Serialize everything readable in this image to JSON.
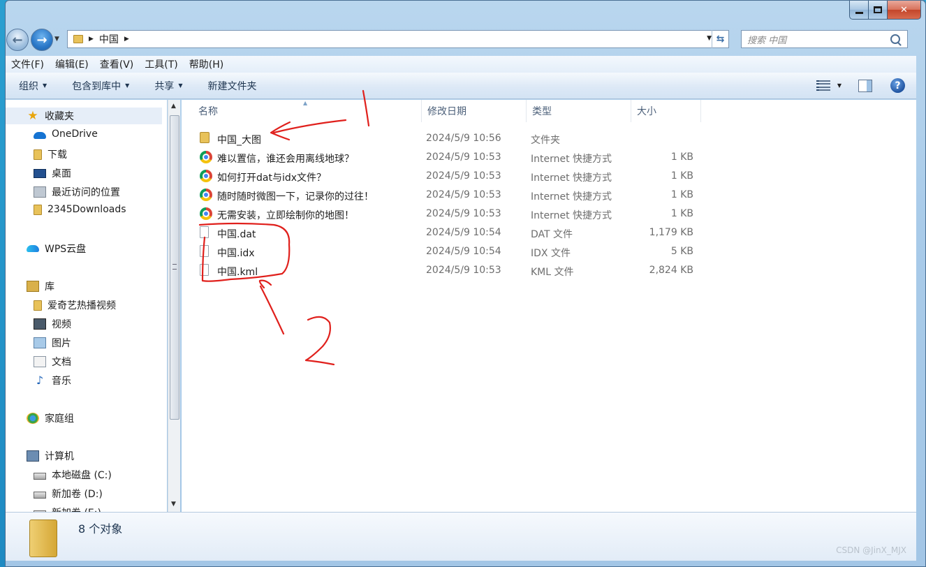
{
  "window": {
    "caption_min": "minimize",
    "caption_max": "maximize",
    "caption_close": "✕"
  },
  "address": {
    "path": "中国",
    "search_placeholder": "搜索 中国"
  },
  "menu": [
    "文件(F)",
    "编辑(E)",
    "查看(V)",
    "工具(T)",
    "帮助(H)"
  ],
  "commands": [
    "组织",
    "包含到库中",
    "共享",
    "新建文件夹"
  ],
  "nav": {
    "favorites": "收藏夹",
    "fav_items": [
      "OneDrive",
      "下载",
      "桌面",
      "最近访问的位置",
      "2345Downloads"
    ],
    "wps": "WPS云盘",
    "library": "库",
    "lib_items": [
      "爱奇艺热播视频",
      "视频",
      "图片",
      "文档",
      "音乐"
    ],
    "homegroup": "家庭组",
    "computer": "计算机",
    "drives": [
      "本地磁盘 (C:)",
      "新加卷 (D:)",
      "新加卷 (E:)"
    ]
  },
  "columns": {
    "name": "名称",
    "date": "修改日期",
    "type": "类型",
    "size": "大小"
  },
  "files": [
    {
      "icon": "folder-icon",
      "name": "中国_大图",
      "date": "2024/5/9 10:56",
      "type": "文件夹",
      "size": ""
    },
    {
      "icon": "chrome-icon",
      "name": "难以置信，谁还会用离线地球？",
      "date": "2024/5/9 10:53",
      "type": "Internet 快捷方式",
      "size": "1 KB"
    },
    {
      "icon": "chrome-icon",
      "name": "如何打开dat与idx文件？",
      "date": "2024/5/9 10:53",
      "type": "Internet 快捷方式",
      "size": "1 KB"
    },
    {
      "icon": "chrome-icon",
      "name": "随时随时微图一下，记录你的过往！",
      "date": "2024/5/9 10:53",
      "type": "Internet 快捷方式",
      "size": "1 KB"
    },
    {
      "icon": "chrome-icon",
      "name": "无需安装，立即绘制你的地图！",
      "date": "2024/5/9 10:53",
      "type": "Internet 快捷方式",
      "size": "1 KB"
    },
    {
      "icon": "file-icon",
      "name": "中国.dat",
      "date": "2024/5/9 10:54",
      "type": "DAT 文件",
      "size": "1,179 KB"
    },
    {
      "icon": "file-icon",
      "name": "中国.idx",
      "date": "2024/5/9 10:54",
      "type": "IDX 文件",
      "size": "5 KB"
    },
    {
      "icon": "file-icon",
      "name": "中国.kml",
      "date": "2024/5/9 10:53",
      "type": "KML 文件",
      "size": "2,824 KB"
    }
  ],
  "details": {
    "count": "8 个对象"
  },
  "watermark": "CSDN @JinX_MJX",
  "annotation_color": "#e0201c"
}
